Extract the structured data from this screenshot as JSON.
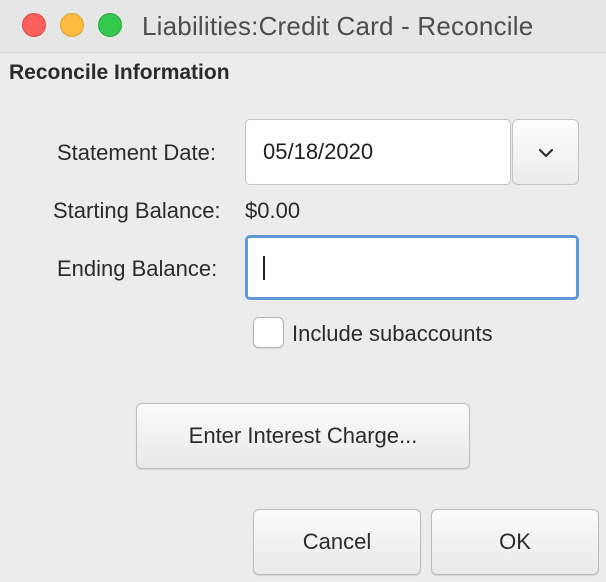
{
  "window": {
    "title": "Liabilities:Credit Card - Reconcile"
  },
  "section": {
    "heading": "Reconcile Information"
  },
  "form": {
    "statement_date_label": "Statement Date:",
    "statement_date_value": "05/18/2020",
    "starting_balance_label": "Starting Balance:",
    "starting_balance_value": "$0.00",
    "ending_balance_label": "Ending Balance:",
    "ending_balance_value": "",
    "include_subaccounts_label": "Include subaccounts",
    "include_subaccounts_checked": false
  },
  "buttons": {
    "interest_label": "Enter Interest Charge...",
    "cancel_label": "Cancel",
    "ok_label": "OK"
  },
  "icons": {
    "close": "close-light-icon",
    "minimize": "minimize-light-icon",
    "maximize": "maximize-light-icon",
    "dropdown": "chevron-down-icon"
  },
  "colors": {
    "close": "#fc605c",
    "minimize": "#fdbc40",
    "maximize": "#34c84a",
    "focus_ring": "#5d9ad8"
  }
}
